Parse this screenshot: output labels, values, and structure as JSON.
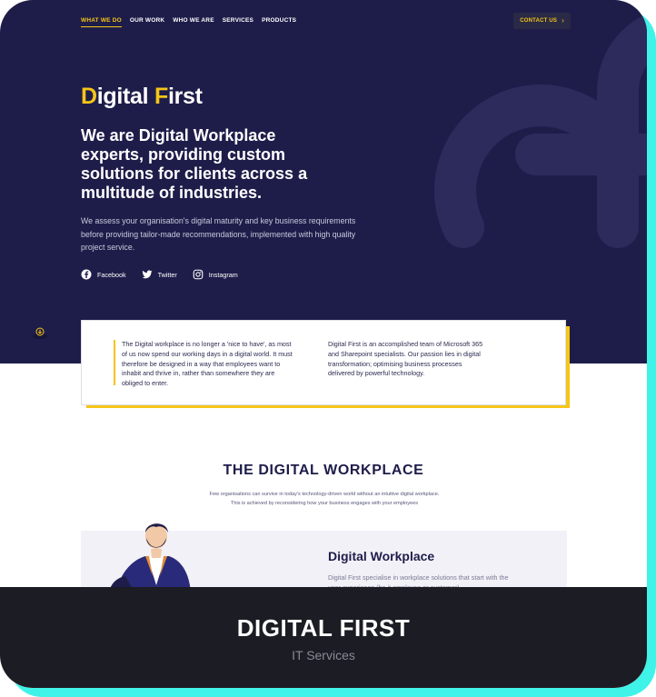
{
  "nav": {
    "items": [
      "WHAT WE DO",
      "OUR WORK",
      "WHO WE ARE",
      "SERVICES",
      "PRODUCTS"
    ],
    "contact_label": "CONTACT US",
    "contact_icon": "arrow-right-icon"
  },
  "hero": {
    "logo_first_letter": "D",
    "logo_rest_1": "igital ",
    "logo_second_letter": "F",
    "logo_rest_2": "irst",
    "title": "We are Digital Workplace experts, providing custom solutions for clients across a multitude of industries.",
    "description": "We assess your organisation's digital maturity and key business requirements before providing tailor-made recommendations, implemented with high quality project service.",
    "socials": [
      {
        "label": "Facebook",
        "icon": "facebook-icon"
      },
      {
        "label": "Twitter",
        "icon": "twitter-icon"
      },
      {
        "label": "Instagram",
        "icon": "instagram-icon"
      }
    ]
  },
  "quote": {
    "left": "The Digital workplace is no longer a 'nice to have', as most of us now spend our working days in a digital world. It must therefore be designed in a way that employees want to inhabit and thrive in, rather than somewhere they are obliged to enter.",
    "right": "Digital First is an accomplished team of Microsoft 365 and Sharepoint specialists. Our passion lies in digital transformation; optimising business processes delivered by powerful technology."
  },
  "section": {
    "title": "THE DIGITAL WORKPLACE",
    "subtitle": "Few organisations can survive in today's technology-driven world without an intuitive digital workplace. This is achieved by reconsidering how your business engages with your employees"
  },
  "feature": {
    "title": "Digital Workplace",
    "text": "Digital First specialise in workplace solutions that start with the user experience (be it employee or customer)."
  },
  "footer": {
    "title": "DIGITAL FIRST",
    "subtitle": "IT Services"
  },
  "colors": {
    "navy": "#1e1d4a",
    "accent": "#f5c518",
    "teal": "#3ff3e9",
    "footer": "#1c1c24"
  }
}
